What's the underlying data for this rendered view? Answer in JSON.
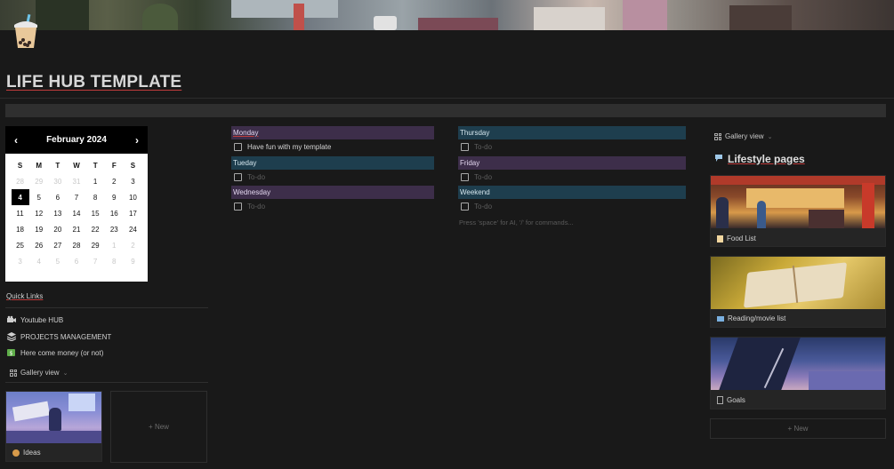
{
  "page": {
    "title": "LIFE HUB TEMPLATE",
    "icon": "bubble-tea-icon"
  },
  "calendar": {
    "month_label": "February 2024",
    "prev_label": "‹",
    "next_label": "›",
    "weekdays": [
      "S",
      "M",
      "T",
      "W",
      "T",
      "F",
      "S"
    ],
    "days": [
      "28",
      "29",
      "30",
      "31",
      "1",
      "2",
      "3",
      "4",
      "5",
      "6",
      "7",
      "8",
      "9",
      "10",
      "11",
      "12",
      "13",
      "14",
      "15",
      "16",
      "17",
      "18",
      "19",
      "20",
      "21",
      "22",
      "23",
      "24",
      "25",
      "26",
      "27",
      "28",
      "29",
      "1",
      "2",
      "3",
      "4",
      "5",
      "6",
      "7",
      "8",
      "9"
    ],
    "selected_day": "4"
  },
  "quick_links": {
    "title": "Quick Links",
    "items": [
      {
        "label": "Youtube HUB",
        "icon": "video-camera-icon"
      },
      {
        "label": "PROJECTS MANAGEMENT",
        "icon": "layers-icon"
      },
      {
        "label": "Here come money (or not)",
        "icon": "money-icon"
      }
    ]
  },
  "left_gallery": {
    "view_label": "Gallery view",
    "cards": [
      {
        "label": "Ideas",
        "icon": "palette-icon"
      }
    ],
    "new_label": "+ New"
  },
  "week": {
    "days": [
      {
        "name": "Monday",
        "todo": "Have fun with my template",
        "is_placeholder": false
      },
      {
        "name": "Tueday",
        "todo": "To-do",
        "is_placeholder": true
      },
      {
        "name": "Wednesday",
        "todo": "To-do",
        "is_placeholder": true
      },
      {
        "name": "Thursday",
        "todo": "To-do",
        "is_placeholder": true
      },
      {
        "name": "Friday",
        "todo": "To-do",
        "is_placeholder": true
      },
      {
        "name": "Weekend",
        "todo": "To-do",
        "is_placeholder": true
      }
    ],
    "hint": "Press 'space' for AI, '/' for commands..."
  },
  "right_gallery": {
    "view_label": "Gallery view",
    "section_title": "Lifestyle pages",
    "cards": [
      {
        "label": "Food List",
        "icon": "note-icon"
      },
      {
        "label": "Reading/movie list",
        "icon": "book-icon"
      },
      {
        "label": "Goals",
        "icon": "document-icon"
      }
    ],
    "new_label": "+ New"
  },
  "colors": {
    "background": "#191919",
    "purple_header": "#3d2e4a",
    "teal_header": "#1e3e4e",
    "red_underline": "#c03c3c"
  }
}
